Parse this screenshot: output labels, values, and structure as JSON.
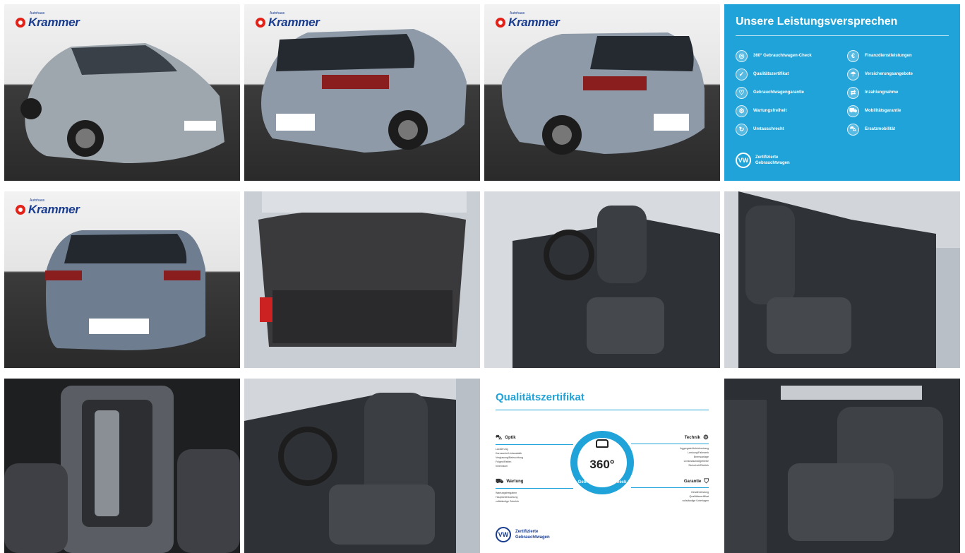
{
  "dealer": {
    "brand_name": "Krammer",
    "brand_tagline": "Autohaus"
  },
  "vw_badge": {
    "glyph": "VW",
    "text": "Zertifizierte\nGebrauchtwagen"
  },
  "promise": {
    "title": "Unsere Leistungsversprechen",
    "items": [
      {
        "label": "360° Gebrauchtwagen-Check",
        "icon": "360-check-icon",
        "glyph": "◎"
      },
      {
        "label": "Finanzdienstleistungen",
        "icon": "finance-icon",
        "glyph": "€"
      },
      {
        "label": "Qualitätszertifikat",
        "icon": "certificate-icon",
        "glyph": "✓"
      },
      {
        "label": "Versicherungsangebote",
        "icon": "insurance-icon",
        "glyph": "☂"
      },
      {
        "label": "Gebrauchtwagengarantie",
        "icon": "warranty-icon",
        "glyph": "♡"
      },
      {
        "label": "Inzahlungnahme",
        "icon": "trade-in-icon",
        "glyph": "⇄"
      },
      {
        "label": "Wartungsfreiheit",
        "icon": "service-icon",
        "glyph": "⚙"
      },
      {
        "label": "Mobilitätsgarantie",
        "icon": "mobility-icon",
        "glyph": "⛟"
      },
      {
        "label": "Umtauschrecht",
        "icon": "exchange-icon",
        "glyph": "↻"
      },
      {
        "label": "Ersatzmobilität",
        "icon": "replacement-car-icon",
        "glyph": "⛍"
      }
    ]
  },
  "certificate": {
    "title": "Qualitätszertifikat",
    "badge_number": "360°",
    "badge_text": "Gebrauchtwagen-Check",
    "sections": [
      {
        "title": "Optik",
        "side": "left",
        "lines": [
          "Lackierung",
          "Karosserie/Unbaustatik",
          "Verglasung/Beleuchtung",
          "Felgen/Reifen",
          "Innenraum"
        ]
      },
      {
        "title": "Technik",
        "side": "right",
        "lines": [
          "Aggregate/Antriebsstrang",
          "Lenkung/Fahrwerk",
          "Bremsanlage",
          "Lenkradschaltgetriebe",
          "Sicherheit/Elektrik"
        ]
      },
      {
        "title": "Wartung",
        "side": "left",
        "lines": [
          "Wartungsfreigaben",
          "Hauptuntersuchung",
          "vollständige Zubehör"
        ]
      },
      {
        "title": "Garantie",
        "side": "right",
        "lines": [
          "Gewährleistung",
          "Qualitätszertifikat",
          "vollständige Unterlagen"
        ]
      }
    ]
  },
  "colors": {
    "accent": "#1fa3d8",
    "brand_red": "#e2231a",
    "brand_blue": "#1a3d8f",
    "car_grey": "#8e9aa6"
  }
}
